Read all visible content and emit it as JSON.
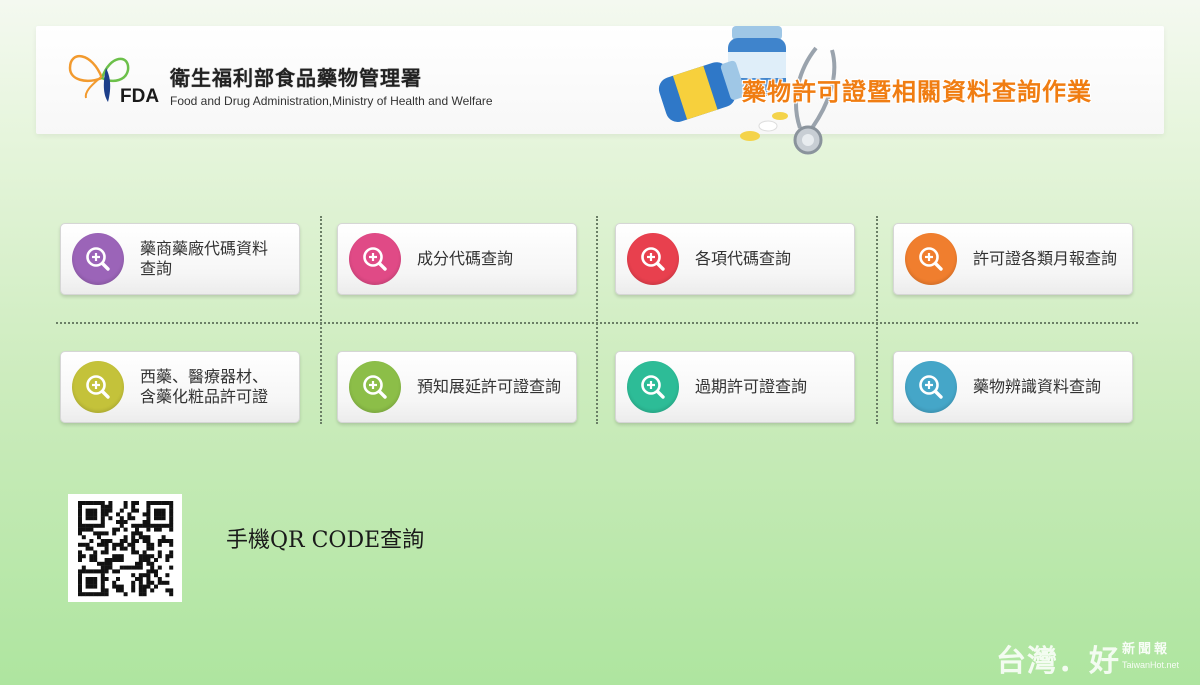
{
  "header": {
    "org_name_zh": "衛生福利部食品藥物管理署",
    "fda_mark": "FDA",
    "org_name_en": "Food and Drug Administration,Ministry of Health and Welfare",
    "app_title": "藥物許可證暨相關資料查詢作業"
  },
  "buttons": [
    {
      "label": "藥商藥廠代碼資料\n查詢",
      "color": "#9b64b8"
    },
    {
      "label": "成分代碼查詢",
      "color": "#e04a86"
    },
    {
      "label": "各項代碼查詢",
      "color": "#e8404e"
    },
    {
      "label": "許可證各類月報查詢",
      "color": "#f07e2e"
    },
    {
      "label": "西藥、醫療器材、\n含藥化粧品許可證",
      "color": "#c4c23a"
    },
    {
      "label": "預知展延許可證查詢",
      "color": "#8cbe48"
    },
    {
      "label": "過期許可證查詢",
      "color": "#2dbc97"
    },
    {
      "label": "藥物辨識資料查詢",
      "color": "#45a6c8"
    }
  ],
  "qr": {
    "label": "手機QR CODE查詢"
  },
  "watermark": {
    "main": "台灣．好",
    "small": "新聞報",
    "url": "TaiwanHot.net"
  }
}
